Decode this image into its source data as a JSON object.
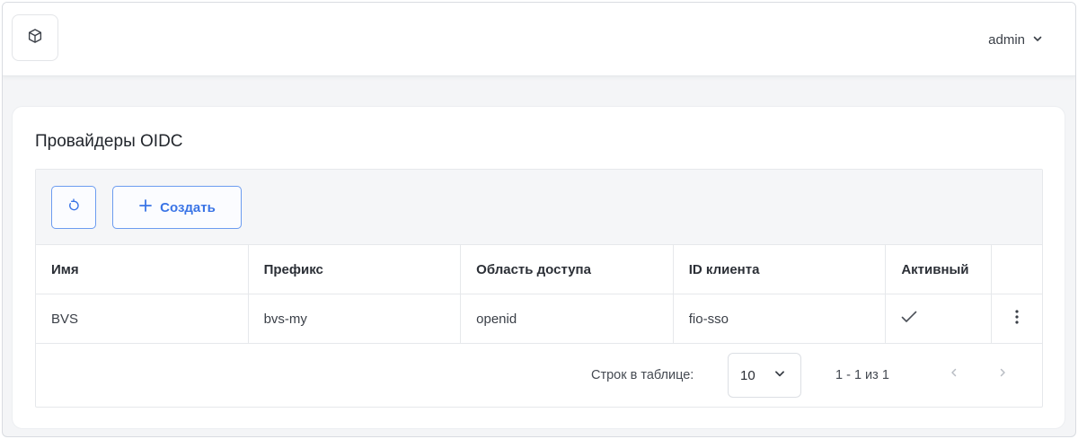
{
  "header": {
    "logo_icon": "cube-icon",
    "user_name": "admin",
    "user_menu_icon": "chevron-down-icon"
  },
  "page": {
    "title": "Провайдеры OIDC"
  },
  "toolbar": {
    "refresh_icon": "refresh-icon",
    "create_icon": "plus-icon",
    "create_label": "Создать",
    "accent_color": "#3a74e6"
  },
  "table": {
    "columns": [
      "Имя",
      "Префикс",
      "Область доступа",
      "ID клиента",
      "Активный"
    ],
    "rows": [
      {
        "name": "BVS",
        "prefix": "bvs-my",
        "scope": "openid",
        "client_id": "fio-sso",
        "active_icon": "check-icon",
        "actions_icon": "more-vertical-icon"
      }
    ]
  },
  "pagination": {
    "rows_per_page_label": "Строк в таблице:",
    "rows_per_page_value": "10",
    "range_text": "1 - 1 из 1",
    "prev_icon": "chevron-left-icon",
    "next_icon": "chevron-right-icon"
  }
}
